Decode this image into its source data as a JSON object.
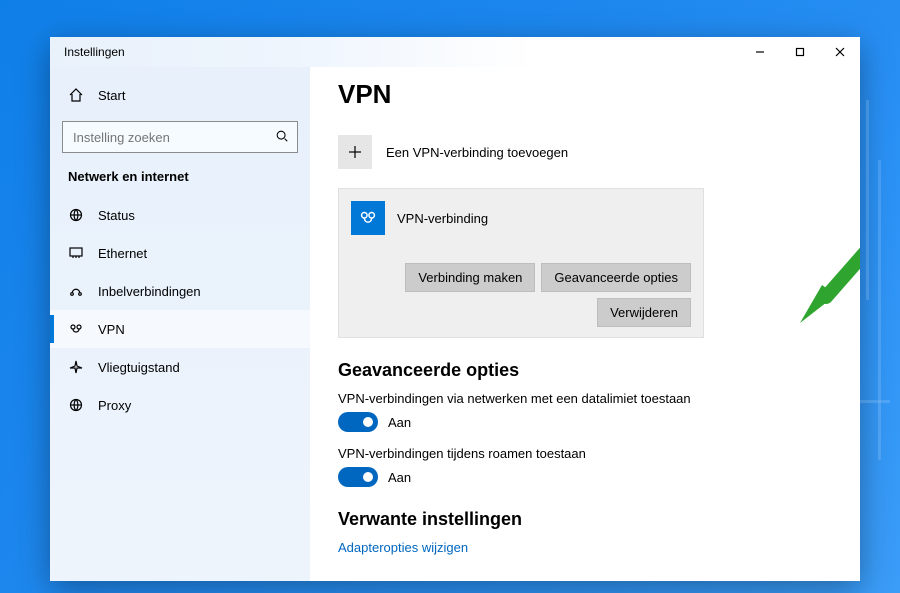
{
  "window": {
    "title": "Instellingen"
  },
  "sidebar": {
    "home": "Start",
    "search_placeholder": "Instelling zoeken",
    "section": "Netwerk en internet",
    "items": [
      {
        "label": "Status",
        "icon": "status-icon",
        "active": false
      },
      {
        "label": "Ethernet",
        "icon": "ethernet-icon",
        "active": false
      },
      {
        "label": "Inbelverbindingen",
        "icon": "dialup-icon",
        "active": false
      },
      {
        "label": "VPN",
        "icon": "vpn-icon",
        "active": true
      },
      {
        "label": "Vliegtuigstand",
        "icon": "airplane-icon",
        "active": false
      },
      {
        "label": "Proxy",
        "icon": "proxy-icon",
        "active": false
      }
    ]
  },
  "page": {
    "title": "VPN",
    "add_label": "Een VPN-verbinding toevoegen",
    "vpn_item": {
      "name": "VPN-verbinding",
      "connect": "Verbinding maken",
      "advanced": "Geavanceerde opties",
      "remove": "Verwijderen"
    },
    "advanced_section": {
      "title": "Geavanceerde opties",
      "opt1_label": "VPN-verbindingen via netwerken met een datalimiet toestaan",
      "opt1_state": "Aan",
      "opt2_label": "VPN-verbindingen tijdens roamen toestaan",
      "opt2_state": "Aan"
    },
    "related_section": {
      "title": "Verwante instellingen",
      "link1": "Adapteropties wijzigen"
    }
  },
  "annotation": {
    "arrow_color": "#2fa52f"
  }
}
